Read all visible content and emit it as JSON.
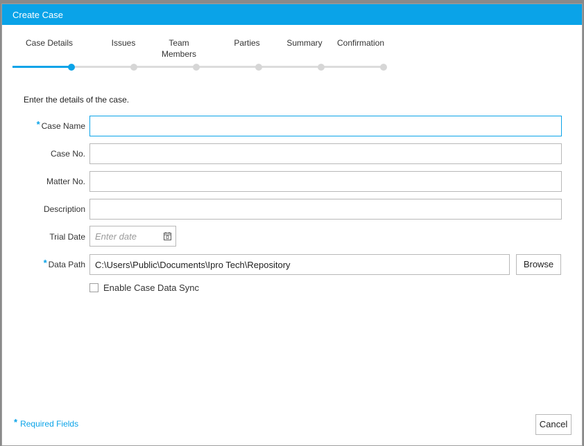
{
  "window": {
    "title": "Create Case"
  },
  "steps": [
    {
      "label": "Case Details",
      "state": "active"
    },
    {
      "label": "Issues",
      "state": "pending"
    },
    {
      "label": "Team\nMembers",
      "state": "pending"
    },
    {
      "label": "Parties",
      "state": "pending"
    },
    {
      "label": "Summary",
      "state": "pending"
    },
    {
      "label": "Confirmation",
      "state": "pending"
    }
  ],
  "form": {
    "intro": "Enter the details of the case.",
    "case_name": {
      "label": "Case Name",
      "required": true,
      "value": ""
    },
    "case_no": {
      "label": "Case No.",
      "value": ""
    },
    "matter_no": {
      "label": "Matter No.",
      "value": ""
    },
    "description": {
      "label": "Description",
      "value": ""
    },
    "trial_date": {
      "label": "Trial Date",
      "placeholder": "Enter date",
      "value": ""
    },
    "data_path": {
      "label": "Data Path",
      "required": true,
      "value": "C:\\Users\\Public\\Documents\\Ipro Tech\\Repository"
    },
    "browse_label": "Browse",
    "sync_label": "Enable Case Data Sync",
    "sync_checked": false
  },
  "footer": {
    "required_star": "*",
    "required_note": "Required Fields",
    "cancel_label": "Cancel"
  },
  "colors": {
    "accent": "#0aa3e8"
  }
}
